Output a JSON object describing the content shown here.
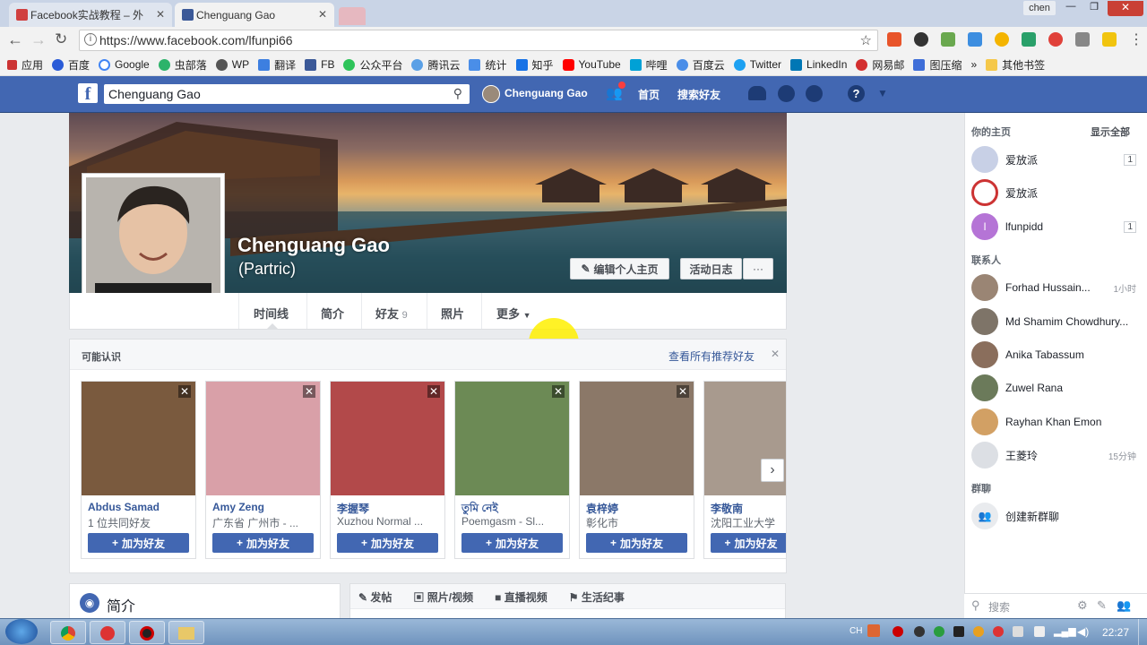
{
  "browser": {
    "tabs": [
      {
        "title": "Facebook实战教程 – 外",
        "active": false
      },
      {
        "title": "Chenguang Gao",
        "active": true
      }
    ],
    "window_user": "chen",
    "url": "https://www.facebook.com/lfunpi66",
    "bookmarks": [
      "应用",
      "百度",
      "Google",
      "虫部落",
      "WP",
      "翻译",
      "FB",
      "公众平台",
      "腾讯云",
      "统计",
      "知乎",
      "YouTube",
      "哔哩",
      "百度云",
      "Twitter",
      "LinkedIn",
      "网易邮",
      "图压缩"
    ],
    "other_bookmarks": "其他书签",
    "more": "»"
  },
  "fb": {
    "search_value": "Chenguang Gao",
    "user_name": "Chenguang Gao",
    "nav_home": "首页",
    "nav_find_friends": "搜索好友",
    "brand_color": "#4267b2"
  },
  "profile": {
    "name": "Chenguang Gao",
    "alt_name": "(Partric)",
    "edit_button": "编辑个人主页",
    "activity_log": "活动日志",
    "more_dots": "···",
    "tabs": [
      {
        "label": "时间线"
      },
      {
        "label": "简介"
      },
      {
        "label": "好友",
        "count": "9"
      },
      {
        "label": "照片"
      },
      {
        "label": "更多"
      }
    ]
  },
  "pymk": {
    "title": "可能认识",
    "see_all": "查看所有推荐好友",
    "close": "✕",
    "add_label": "加为好友",
    "people": [
      {
        "name": "Abdus Samad",
        "sub": "1 位共同好友",
        "color": "#7a5a3e"
      },
      {
        "name": "Amy Zeng",
        "sub": "广东省 广州市 - ...",
        "color": "#d9a0a8"
      },
      {
        "name": "李握琴",
        "sub": "Xuzhou Normal ...",
        "color": "#b2494a"
      },
      {
        "name": "তুমি নেই",
        "sub": "Poemgasm - Sl...",
        "color": "#6c8a55"
      },
      {
        "name": "袁梓婷",
        "sub": "彰化市",
        "color": "#8b7868"
      },
      {
        "name": "李敬南",
        "sub": "沈阳工业大学",
        "color": "#a89a8e"
      }
    ]
  },
  "intro": {
    "title": "简介"
  },
  "composer": {
    "post": "发帖",
    "photo": "照片/视频",
    "live": "直播视频",
    "life_event": "生活纪事"
  },
  "sidebar": {
    "your_pages": "你的主页",
    "show_all": "显示全部",
    "pages": [
      {
        "name": "爱放派",
        "badge": "1"
      },
      {
        "name": "爱放派",
        "badge": ""
      },
      {
        "name": "lfunpidd",
        "badge": "1"
      }
    ],
    "contacts_title": "联系人",
    "contacts": [
      {
        "name": "Forhad Hussain...",
        "time": "1小时"
      },
      {
        "name": "Md Shamim Chowdhury...",
        "time": ""
      },
      {
        "name": "Anika Tabassum",
        "time": ""
      },
      {
        "name": "Zuwel Rana",
        "time": ""
      },
      {
        "name": "Rayhan Khan Emon",
        "time": ""
      },
      {
        "name": "王菱玲",
        "time": "15分钟"
      }
    ],
    "groups_title": "群聊",
    "create_group": "创建新群聊",
    "search_placeholder": "搜索"
  },
  "taskbar": {
    "clock": "22:27",
    "lang": "CH"
  }
}
